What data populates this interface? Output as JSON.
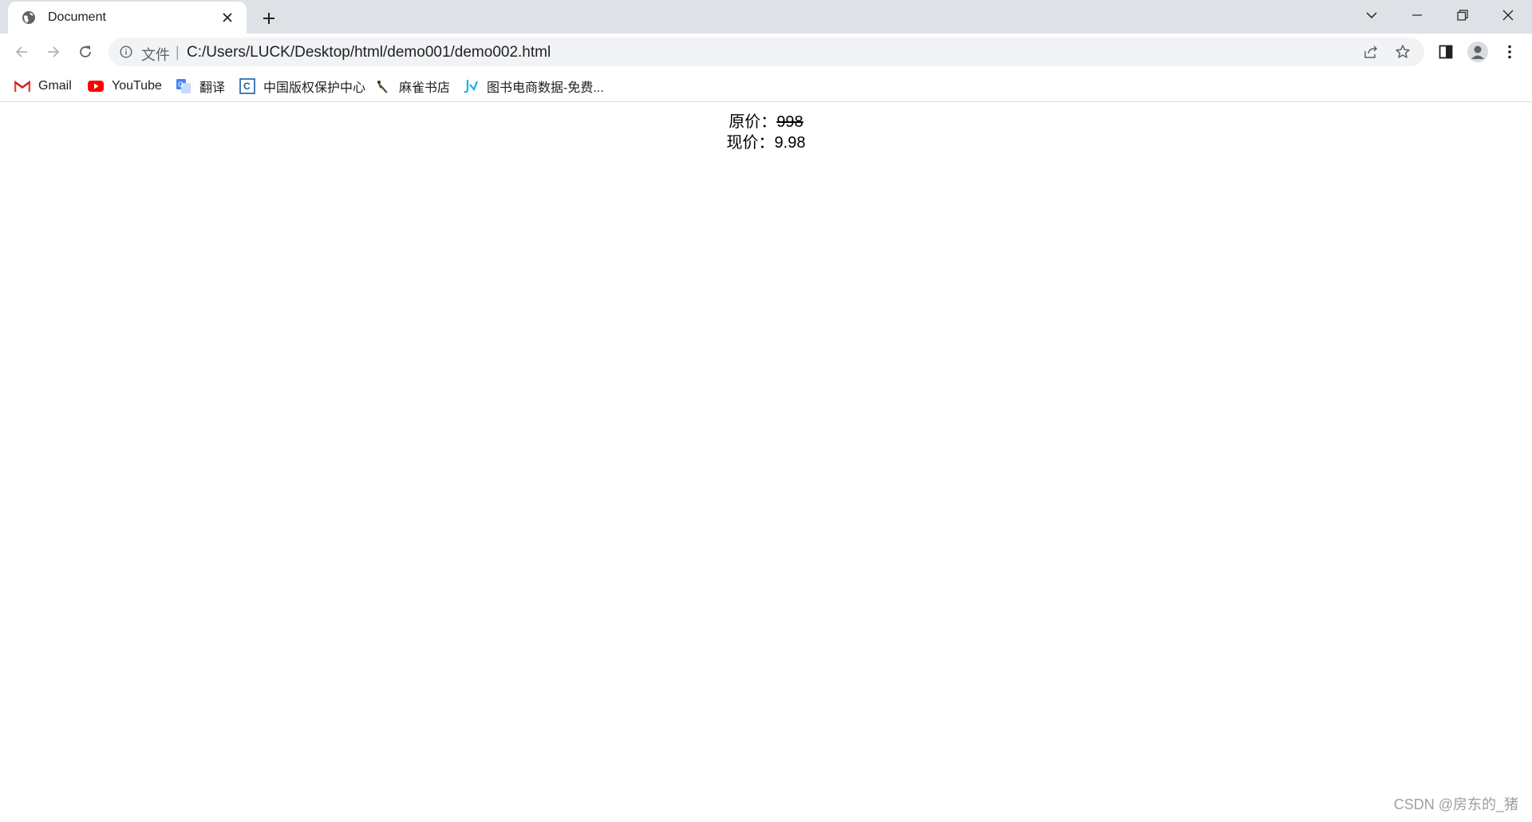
{
  "browser": {
    "tab_title": "Document",
    "new_tab_label": "+",
    "omnibox": {
      "scheme_label": "文件",
      "separator": "|",
      "url": "C:/Users/LUCK/Desktop/html/demo001/demo002.html"
    },
    "bookmarks": [
      {
        "label": "Gmail",
        "icon": "gmail-icon"
      },
      {
        "label": "YouTube",
        "icon": "youtube-icon"
      },
      {
        "label": "翻译",
        "icon": "translate-icon"
      },
      {
        "label": "中国版权保护中心",
        "icon": "copyright-center-icon"
      },
      {
        "label": "麻雀书店",
        "icon": "sparrow-icon"
      },
      {
        "label": "图书电商数据-免费...",
        "icon": "book-data-icon"
      }
    ]
  },
  "page": {
    "original_price_label": "原价：",
    "original_price_value": "998",
    "current_price_label": "现价：",
    "current_price_value": "9.98"
  },
  "watermark": "CSDN @房东的_猪",
  "colors": {
    "tabstrip": "#dee1e6",
    "omnibox": "#f1f3f4",
    "gmail_red": "#ea4335",
    "youtube_red": "#ff0000",
    "translate_blue": "#4285f4"
  }
}
